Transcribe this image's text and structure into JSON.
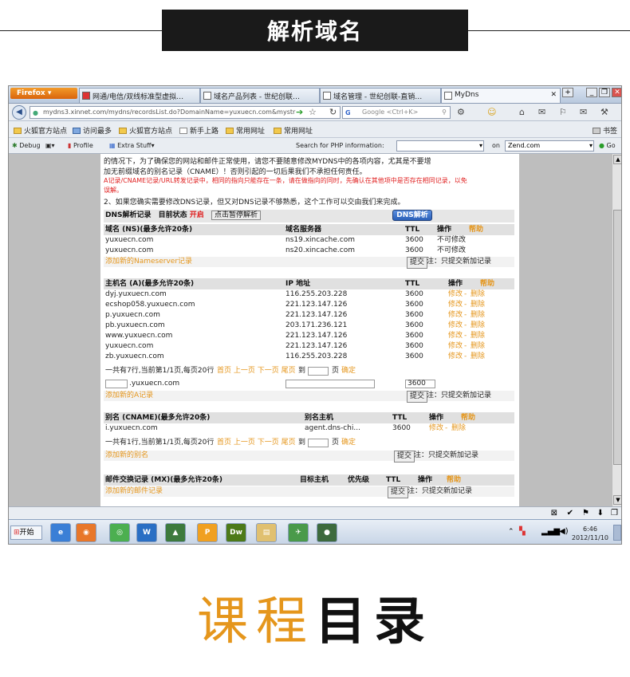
{
  "banner": {
    "title": "解析域名"
  },
  "browser": {
    "app_button": "Firefox",
    "tabs": [
      {
        "label": "网通/电信/双线标准型虚拟…"
      },
      {
        "label": "域名产品列表 - 世纪创联…"
      },
      {
        "label": "域名管理 - 世纪创联-直销…"
      },
      {
        "label": "MyDns"
      }
    ],
    "url": "mydns3.xinnet.com/mydns/recordsList.do?DomainName=yuxuecn.com&mystr",
    "search_placeholder": "Google <Ctrl+K>",
    "bookmarks": [
      "火狐官方站点",
      "访问最多",
      "火狐官方站点",
      "新手上路",
      "常用网址",
      "常用网址"
    ],
    "bookmarks_right": "书签",
    "zend": {
      "debug": "Debug",
      "profile": "Profile",
      "extra": "Extra Stuff",
      "search_label": "Search for PHP information:",
      "on_label": "on",
      "on_value": "Zend.com",
      "go": "Go"
    }
  },
  "page": {
    "notice_lines": [
      "的情况下，为了确保您的网站和邮件正常使用，请您不要随意修改MYDNS中的各项内容，尤其是不要增",
      "加无前缀域名的别名记录（CNAME）！否则引起的一切后果我们不承担任何责任。"
    ],
    "notice_red_1": "A记录/CNAME记录/URL转发记录中，相同的指向只能存在一条，请在做指向的同时，先确认在其他项中是否存在相同记录，以免",
    "notice_red_2": "误解。",
    "notice_2": "2、如果您确实需要修改DNS记录，但又对DNS记录不够熟悉，这个工作可以交由我们来完成。",
    "dns_header": {
      "label": "DNS解析记录",
      "status_label": "目前状态",
      "status_value": "开启",
      "pause_button": "点击暂停解析",
      "dns_button": "DNS解析"
    },
    "ns": {
      "headers": [
        "域名 (NS)(最多允许20条)",
        "域名服务器",
        "TTL",
        "操作",
        "帮助"
      ],
      "rows": [
        {
          "domain": "yuxuecn.com",
          "server": "ns19.xincache.com",
          "ttl": "3600",
          "op": "不可修改"
        },
        {
          "domain": "yuxuecn.com",
          "server": "ns20.xincache.com",
          "ttl": "3600",
          "op": "不可修改"
        }
      ],
      "add_link": "添加新的Nameserver记录",
      "submit": "提交",
      "note": "注：只提交新加记录"
    },
    "a": {
      "headers": [
        "主机名 (A)(最多允许20条)",
        "IP 地址",
        "TTL",
        "操作",
        "帮助"
      ],
      "rows": [
        {
          "host": "dyj.yuxuecn.com",
          "ip": "116.255.203.228",
          "ttl": "3600"
        },
        {
          "host": "ecshop058.yuxuecn.com",
          "ip": "221.123.147.126",
          "ttl": "3600"
        },
        {
          "host": "p.yuxuecn.com",
          "ip": "221.123.147.126",
          "ttl": "3600"
        },
        {
          "host": "pb.yuxuecn.com",
          "ip": "203.171.236.121",
          "ttl": "3600"
        },
        {
          "host": "www.yuxuecn.com",
          "ip": "221.123.147.126",
          "ttl": "3600"
        },
        {
          "host": "yuxuecn.com",
          "ip": "221.123.147.126",
          "ttl": "3600"
        },
        {
          "host": "zb.yuxuecn.com",
          "ip": "116.255.203.228",
          "ttl": "3600"
        }
      ],
      "op_edit": "修改",
      "op_sep": "-",
      "op_delete": "删除",
      "pagination": "一共有7行,当前第1/1页,每页20行",
      "page_links": "首页 上一页 下一页 尾页",
      "goto_label": "到",
      "page_label": "页",
      "confirm": "确定",
      "new_suffix": ".yuxuecn.com",
      "new_ttl": "3600",
      "add_link": "添加新的A记录",
      "submit": "提交",
      "note": "注：只提交新加记录"
    },
    "cname": {
      "headers": [
        "别名 (CNAME)(最多允许20条)",
        "别名主机",
        "TTL",
        "操作",
        "帮助"
      ],
      "rows": [
        {
          "alias": "i.yuxuecn.com",
          "host": "agent.dns-chi...",
          "ttl": "3600"
        }
      ],
      "op_edit": "修改",
      "op_sep": "-",
      "op_delete": "删除",
      "pagination": "一共有1行,当前第1/1页,每页20行",
      "page_links": "首页 上一页 下一页 尾页",
      "goto_label": "到",
      "page_label": "页",
      "confirm": "确定",
      "add_link": "添加新的别名",
      "submit": "提交",
      "note": "注：只提交新加记录"
    },
    "mx": {
      "headers": [
        "邮件交换记录 (MX)(最多允许20条)",
        "目标主机",
        "优先级",
        "TTL",
        "操作",
        "帮助"
      ],
      "add_link": "添加新的邮件记录",
      "submit": "提交",
      "note": "注：只提交新加记录"
    }
  },
  "taskbar": {
    "start": "开始",
    "icons": [
      "W",
      "P",
      "Dw"
    ],
    "time": "6:46",
    "date": "2012/11/10"
  },
  "footer": {
    "part1": "课程",
    "part2": "目录"
  },
  "colors": {
    "accent_orange": "#e5961c",
    "alert_red": "#e02020",
    "banner_bg": "#1a1a1a"
  }
}
